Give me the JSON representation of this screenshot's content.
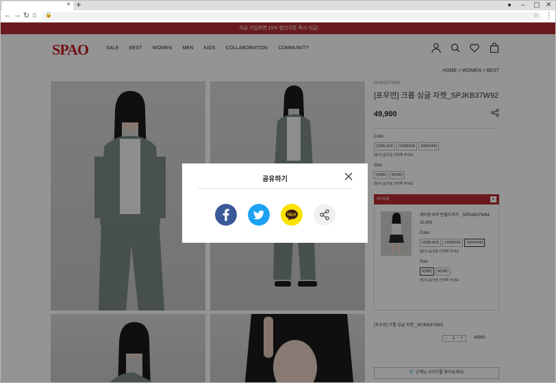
{
  "browser": {
    "tab_close": "×",
    "new_tab": "+",
    "back": "←",
    "forward": "→",
    "reload": "↻",
    "home": "⌂",
    "win_min": "–",
    "win_max": "▢",
    "win_close": "✕"
  },
  "promo": "지금 가입하면 15% 할인쿠폰 즉시 지급!",
  "logo": "SPAO",
  "nav": [
    "SALE",
    "BEST",
    "WOMEN",
    "MEN",
    "KIDS",
    "COLLABORATION",
    "COMMUNITY"
  ],
  "header_icons": [
    "user-icon",
    "search-icon",
    "heart-icon",
    "bag-icon"
  ],
  "breadcrumb": "HOME > WOMEN > BEST",
  "product": {
    "code": "SPJKB37W92",
    "name": "[포우먼] 크롭 싱글 자켓_SPJKB37W92",
    "price": "49,900",
    "color_label": "Color",
    "colors": [
      "(19)BLACK",
      "(33)BEIGE",
      "(69)KHAKI"
    ],
    "color_note": "[필수] 옵션을 선택해 주세요",
    "size_label": "Size",
    "sizes": [
      "S(085)",
      "M(090)"
    ],
    "size_note": "[필수] 옵션을 선택해 주세요"
  },
  "coordi": {
    "title": "코디상품",
    "toggle": "▲",
    "item_name": "레터링 R넥 반팔티셔츠 _SPRAB37W94",
    "item_price": "15,900",
    "color_label": "Color",
    "colors": [
      "(19)BLACK",
      "(33)BEIGE",
      "(69)KHAKI"
    ],
    "color_note": "[필수] 옵션을 선택해 주세요",
    "size_label": "Size",
    "sizes": [
      "S(085)",
      "M(090)"
    ],
    "size_note": "[필수] 옵션을 선택해 주세요"
  },
  "selected": {
    "name": "[포우먼] 크롭 싱글 자켓 _SPJKB37W92",
    "minus": "-",
    "qty": "1",
    "plus": "+",
    "price": "49900"
  },
  "size_finder": "고객님 사이즈를 찾아보세요!",
  "modal": {
    "title": "공유하기",
    "kakao_label": "TALK",
    "buttons": [
      "facebook-icon",
      "twitter-icon",
      "kakaotalk-icon",
      "share-icon"
    ]
  },
  "colors": {
    "brand_red": "#b72d35",
    "facebook": "#3b5998",
    "twitter": "#1da1f2",
    "kakao": "#fae100"
  }
}
